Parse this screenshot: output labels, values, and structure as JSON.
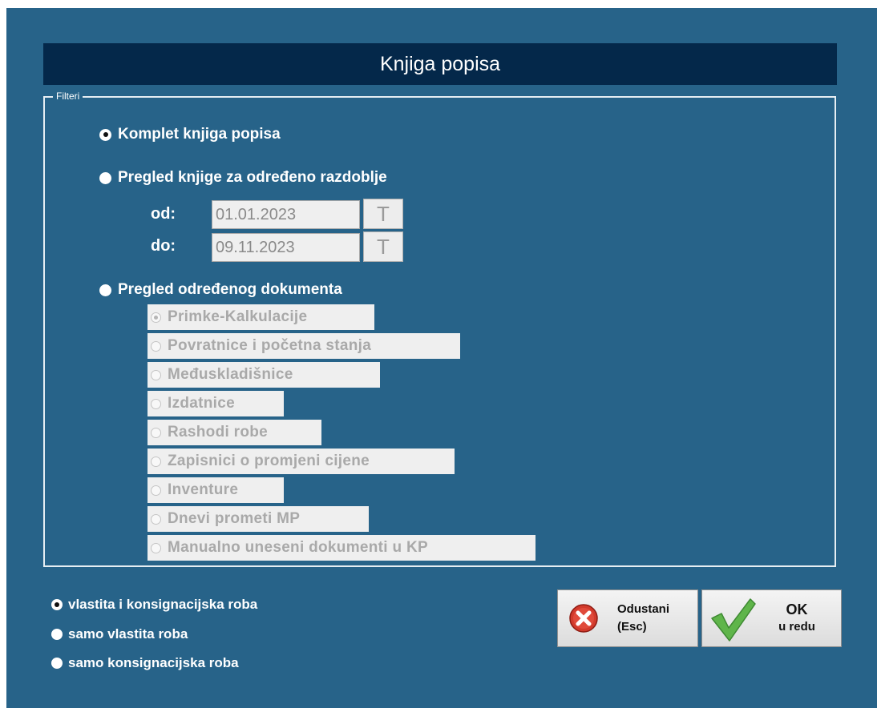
{
  "window": {
    "title": "Knjiga popisa",
    "background": "#276389",
    "title_bar_color": "#04284a"
  },
  "filters": {
    "legend": "Filteri",
    "options": [
      {
        "label": "Komplet knjiga popisa",
        "checked": true
      },
      {
        "label": "Pregled knjige za određeno razdoblje",
        "checked": false
      },
      {
        "label": "Pregled određenog dokumenta",
        "checked": false
      }
    ],
    "date_from_label": "od:",
    "date_from_value": "01.01.2023",
    "date_to_label": "do:",
    "date_to_value": "09.11.2023",
    "date_button_label": "T",
    "documents": [
      {
        "label": "Primke-Kalkulacije",
        "checked": true
      },
      {
        "label": "Povratnice i početna stanja",
        "checked": false
      },
      {
        "label": "Međuskladišnice",
        "checked": false
      },
      {
        "label": "Izdatnice",
        "checked": false
      },
      {
        "label": "Rashodi robe",
        "checked": false
      },
      {
        "label": "Zapisnici o promjeni cijene",
        "checked": false
      },
      {
        "label": "Inventure",
        "checked": false
      },
      {
        "label": "Dnevi prometi MP",
        "checked": false
      },
      {
        "label": "Manualno uneseni dokumenti u KP",
        "checked": false
      }
    ]
  },
  "goods_options": [
    {
      "label": "vlastita i konsignacijska roba",
      "checked": true
    },
    {
      "label": "samo vlastita roba",
      "checked": false
    },
    {
      "label": "samo konsignacijska roba",
      "checked": false
    }
  ],
  "buttons": {
    "cancel_line1": "Odustani",
    "cancel_line2": "(Esc)",
    "cancel_icon": "cancel-x-icon",
    "ok_line1": "OK",
    "ok_line2": "u redu",
    "ok_icon": "checkmark-icon"
  }
}
